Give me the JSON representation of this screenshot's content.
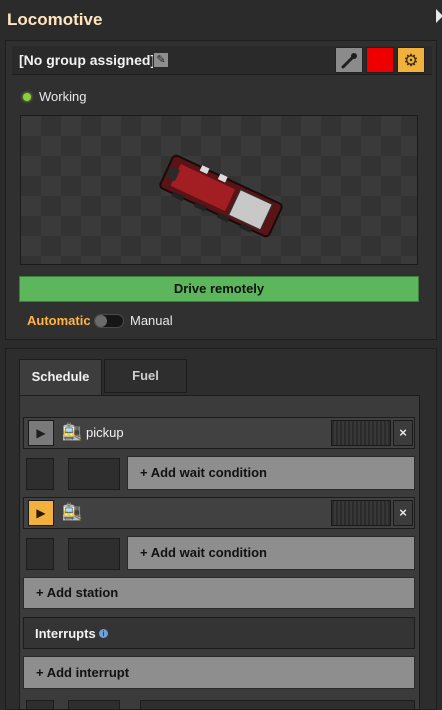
{
  "window": {
    "title": "Locomotive"
  },
  "group": {
    "label": "[No group assigned]",
    "edit_icon": "pencil-icon",
    "picker_icon": "eyedropper-icon",
    "color": "#ee0000",
    "settings_icon": "gear-icon"
  },
  "status": {
    "text": "Working",
    "color": "#8bd23a"
  },
  "controls": {
    "drive_label": "Drive remotely",
    "automatic_label": "Automatic",
    "manual_label": "Manual",
    "mode_selected": "Automatic"
  },
  "tabs": [
    {
      "label": "Schedule",
      "active": true
    },
    {
      "label": "Fuel",
      "active": false
    }
  ],
  "schedule": {
    "stations": [
      {
        "name": "pickup",
        "active": false,
        "wait_label": "+ Add wait condition"
      },
      {
        "name": "",
        "active": true,
        "wait_label": "+ Add wait condition"
      }
    ],
    "add_station_label": "+ Add station",
    "interrupts_label": "Interrupts",
    "add_interrupt_label": "+ Add interrupt"
  },
  "colors": {
    "accent": "#f2b13c",
    "title": "#ffe6c0",
    "automatic": "#ffb445",
    "drive_button": "#5cb65c"
  }
}
